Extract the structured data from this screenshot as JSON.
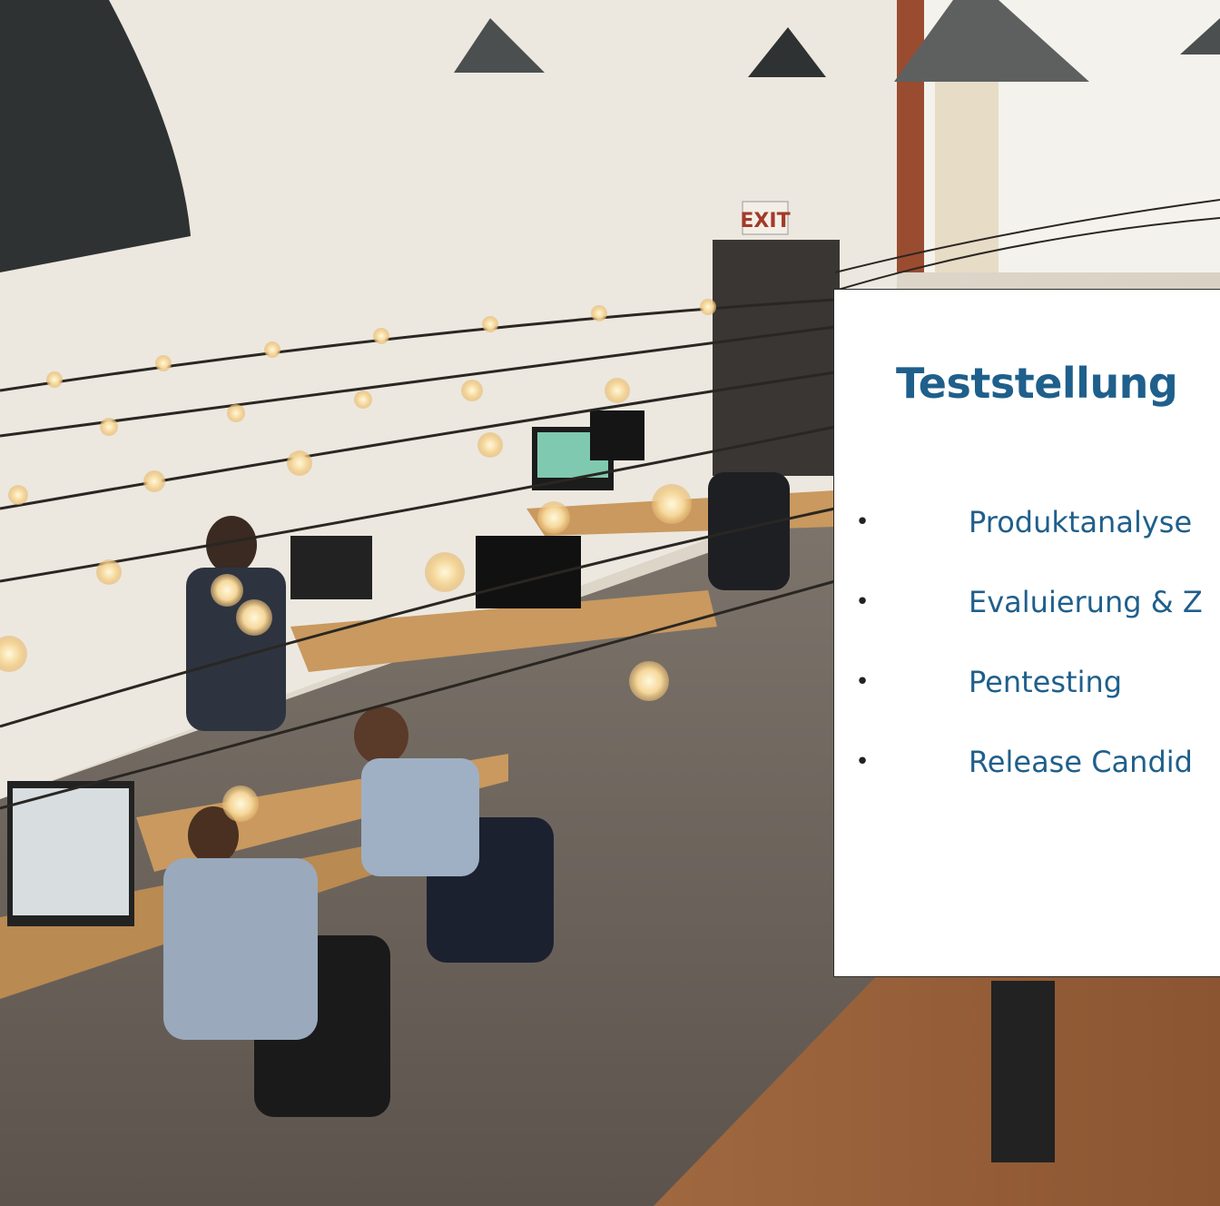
{
  "photo": {
    "description_icon": "coworking-office-photo",
    "wall_sign": "EXIT"
  },
  "card": {
    "title": "Teststellung",
    "bullets": [
      "Produktanalyse",
      "Evaluierung & Z",
      "Pentesting",
      "Release Candid"
    ],
    "colors": {
      "title": "#1f5f8b",
      "text": "#1f5f8b",
      "background": "#ffffff"
    }
  }
}
